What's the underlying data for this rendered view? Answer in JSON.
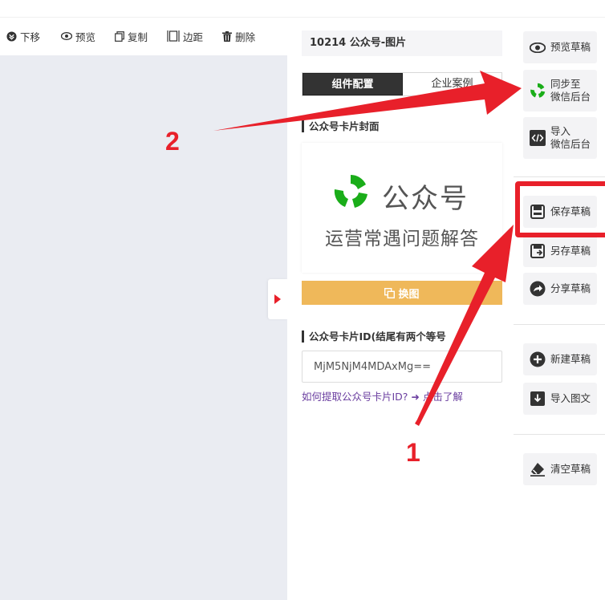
{
  "toolbar": {
    "move_down": "下移",
    "preview": "预览",
    "copy": "复制",
    "margin": "边距",
    "delete": "删除"
  },
  "panel": {
    "title": "10214 公众号-图片",
    "tabs": [
      "组件配置",
      "企业案例"
    ],
    "cover_section": "公众号卡片封面",
    "cover_brand": "公众号",
    "cover_sub": "运营常遇问题解答",
    "swap_button": "换图",
    "id_section": "公众号卡片ID(结尾有两个等号",
    "id_value": "MjM5NjM4MDAxMg==",
    "help_link": "如何提取公众号卡片ID? ➜ 点击了解"
  },
  "sidebar": {
    "preview_draft": "预览草稿",
    "sync_line1": "同步至",
    "sync_line2": "微信后台",
    "import_line1": "导入",
    "import_line2": "微信后台",
    "save_draft": "保存草稿",
    "save_as_draft": "另存草稿",
    "share_draft": "分享草稿",
    "new_draft": "新建草稿",
    "import_article": "导入图文",
    "clear_draft": "清空草稿"
  },
  "annotations": {
    "label_1": "1",
    "label_2": "2"
  },
  "colors": {
    "accent_red": "#e8202a",
    "swap_yellow": "#efb85a",
    "wechat_green": "#1aad19",
    "link_purple": "#6b3fa0"
  },
  "icons": [
    "move-down-icon",
    "eye-icon",
    "copy-icon",
    "margin-icon",
    "trash-icon",
    "wechat-sync-icon",
    "code-icon",
    "save-icon",
    "save-as-icon",
    "share-icon",
    "plus-circle-icon",
    "download-icon",
    "eraser-icon"
  ]
}
